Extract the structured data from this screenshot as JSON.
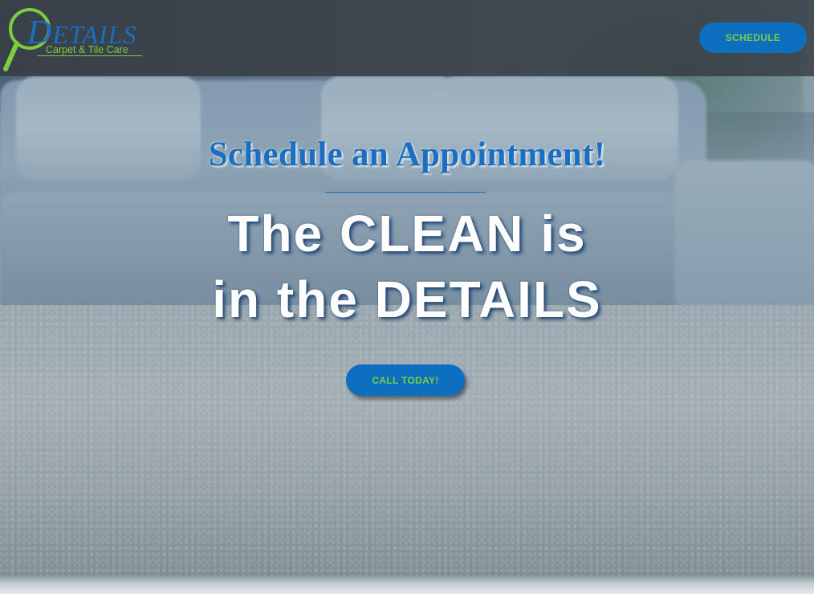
{
  "header": {
    "logo": {
      "word_initial": "D",
      "word_rest": "ETAILS",
      "tagline": "Carpet & Tile Care"
    },
    "schedule_label": "SCHEDULE"
  },
  "hero": {
    "subtitle": "Schedule an Appointment!",
    "headline_line1": "The CLEAN is",
    "headline_line2": "in the DETAILS",
    "cta_label": "CALL TODAY!"
  },
  "colors": {
    "brand_blue": "#0c6fc0",
    "brand_green": "#7ecb3f",
    "header_bg": "#32373e"
  }
}
